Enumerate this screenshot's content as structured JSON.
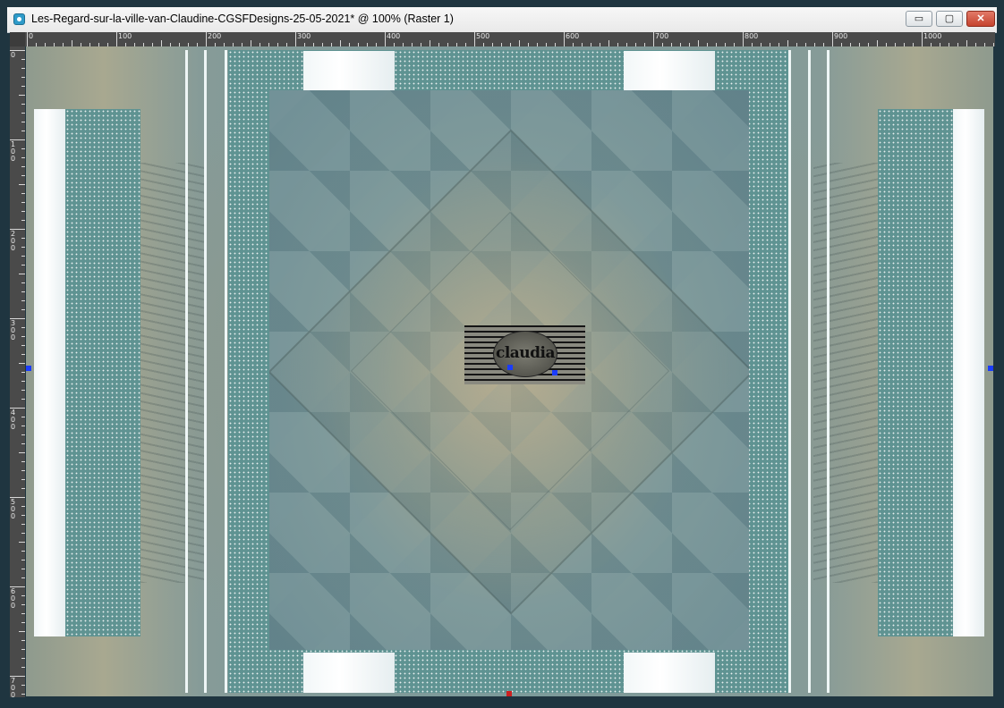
{
  "window": {
    "title": "Les-Regard-sur-la-ville-van-Claudine-CGSFDesigns-25-05-2021* @ 100% (Raster 1)",
    "controls": {
      "minimize": "▭",
      "maximize": "▢",
      "close": "✕"
    }
  },
  "ruler": {
    "top_labels": [
      "0",
      "100",
      "200",
      "300",
      "400",
      "500",
      "600",
      "700",
      "800",
      "900",
      "1000"
    ],
    "left_labels": [
      "0",
      "1\n0\n0",
      "2\n0\n0",
      "3\n0\n0",
      "4\n0\n0",
      "5\n0\n0",
      "6\n0\n0",
      "7\n0\n0"
    ]
  },
  "canvas": {
    "watermark_text": "claudia",
    "colors": {
      "teal": "#5f9392",
      "white": "#ffffff",
      "frame": "#1f3540"
    }
  }
}
